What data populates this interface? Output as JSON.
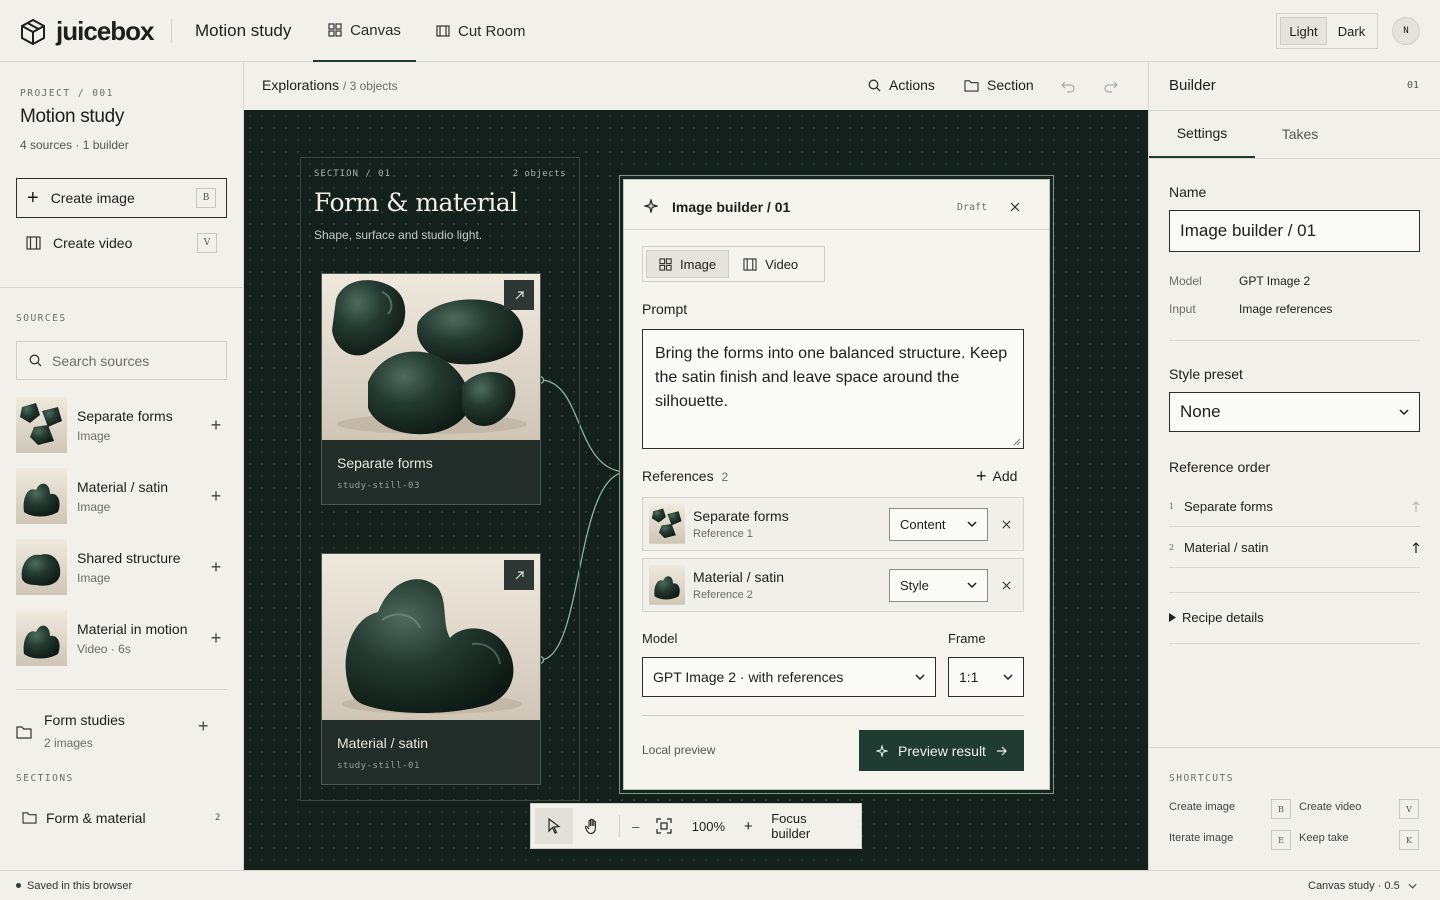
{
  "app": {
    "logo": "juicebox",
    "project_title": "Motion study",
    "tabs": [
      {
        "label": "Canvas",
        "icon": "grid-icon",
        "active": true
      },
      {
        "label": "Cut Room",
        "icon": "film-icon",
        "active": false
      }
    ],
    "theme": {
      "light": "Light",
      "dark": "Dark",
      "selected": "Light"
    },
    "avatar": "N"
  },
  "sidebar": {
    "eyebrow": "PROJECT / 001",
    "title": "Motion study",
    "subtitle": "4 sources · 1 builder",
    "create_image": {
      "label": "Create image",
      "key": "B"
    },
    "create_video": {
      "label": "Create video",
      "key": "V"
    },
    "sources_heading": "SOURCES",
    "search_placeholder": "Search sources",
    "sources": [
      {
        "name": "Separate forms",
        "type": "Image"
      },
      {
        "name": "Material / satin",
        "type": "Image"
      },
      {
        "name": "Shared structure",
        "type": "Image"
      },
      {
        "name": "Material in motion",
        "type": "Video · 6s"
      }
    ],
    "folder": {
      "name": "Form studies",
      "count": "2 images"
    },
    "sections_heading": "SECTIONS",
    "sections": [
      {
        "name": "Form & material",
        "count": "2"
      }
    ]
  },
  "main": {
    "breadcrumb": "Explorations",
    "object_count": "/ 3 objects",
    "actions_label": "Actions",
    "section_label": "Section"
  },
  "canvas": {
    "section": {
      "eyebrow": "SECTION / 01",
      "count": "2 objects",
      "title": "Form & material",
      "subtitle": "Shape, surface and studio light."
    },
    "cards": [
      {
        "name": "Separate forms",
        "id": "study-still-03"
      },
      {
        "name": "Material / satin",
        "id": "study-still-01"
      }
    ],
    "builder": {
      "title": "Image builder / 01",
      "status": "Draft",
      "modes": [
        {
          "label": "Image",
          "active": true
        },
        {
          "label": "Video",
          "active": false
        }
      ],
      "prompt_label": "Prompt",
      "prompt": "Bring the forms into one balanced structure. Keep the satin finish and leave space around the silhouette.",
      "references_label": "References",
      "references_count": "2",
      "add_label": "Add",
      "references": [
        {
          "name": "Separate forms",
          "sub": "Reference 1",
          "role": "Content"
        },
        {
          "name": "Material / satin",
          "sub": "Reference 2",
          "role": "Style"
        }
      ],
      "model_label": "Model",
      "model_value": "GPT Image 2 · with references",
      "frame_label": "Frame",
      "frame_value": "1:1",
      "local_preview": "Local preview",
      "preview_button": "Preview result"
    },
    "toolbar": {
      "zoom": "100%",
      "minus": "–",
      "plus": "+",
      "focus": "Focus builder"
    }
  },
  "right_panel": {
    "title": "Builder",
    "index": "01",
    "tabs": [
      {
        "label": "Settings",
        "active": true
      },
      {
        "label": "Takes",
        "active": false
      }
    ],
    "name_label": "Name",
    "name_value": "Image builder / 01",
    "model_key": "Model",
    "model_value": "GPT Image 2",
    "input_key": "Input",
    "input_value": "Image references",
    "style_preset_label": "Style preset",
    "style_preset_value": "None",
    "reference_order_label": "Reference order",
    "reference_order": [
      {
        "num": "1",
        "name": "Separate forms"
      },
      {
        "num": "2",
        "name": "Material / satin"
      }
    ],
    "recipe_details": "Recipe details",
    "shortcuts_heading": "SHORTCUTS",
    "shortcuts": [
      {
        "label": "Create image",
        "key": "B"
      },
      {
        "label": "Create video",
        "key": "V"
      },
      {
        "label": "Iterate image",
        "key": "E"
      },
      {
        "label": "Keep take",
        "key": "K"
      }
    ]
  },
  "status": {
    "saved": "Saved in this browser",
    "version": "Canvas study · 0.5"
  },
  "colors": {
    "accent": "#1f3b32",
    "canvas_bg": "#13201c",
    "page_bg": "#f1f0ea"
  }
}
